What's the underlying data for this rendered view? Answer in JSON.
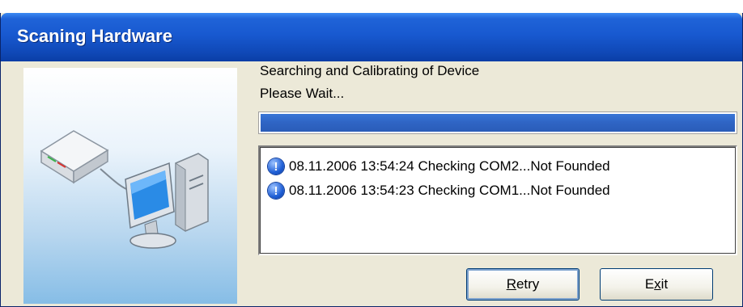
{
  "window": {
    "title": "Scaning Hardware"
  },
  "status": {
    "line1": "Searching and Calibrating of Device",
    "line2": "Please Wait..."
  },
  "progress": {
    "value_percent": 100
  },
  "log": {
    "entries": [
      {
        "icon": "info-icon",
        "text": "08.11.2006 13:54:24 Checking COM2...Not Founded"
      },
      {
        "icon": "info-icon",
        "text": "08.11.2006 13:54:23 Checking COM1...Not Founded"
      }
    ]
  },
  "buttons": {
    "retry": {
      "accel": "R",
      "rest": "etry"
    },
    "exit": {
      "pre": "E",
      "accel": "x",
      "post": "it"
    }
  },
  "colors": {
    "titlebar": "#1859d0",
    "progress_fill": "#2f64c4",
    "dialog_bg": "#ece9d8"
  }
}
